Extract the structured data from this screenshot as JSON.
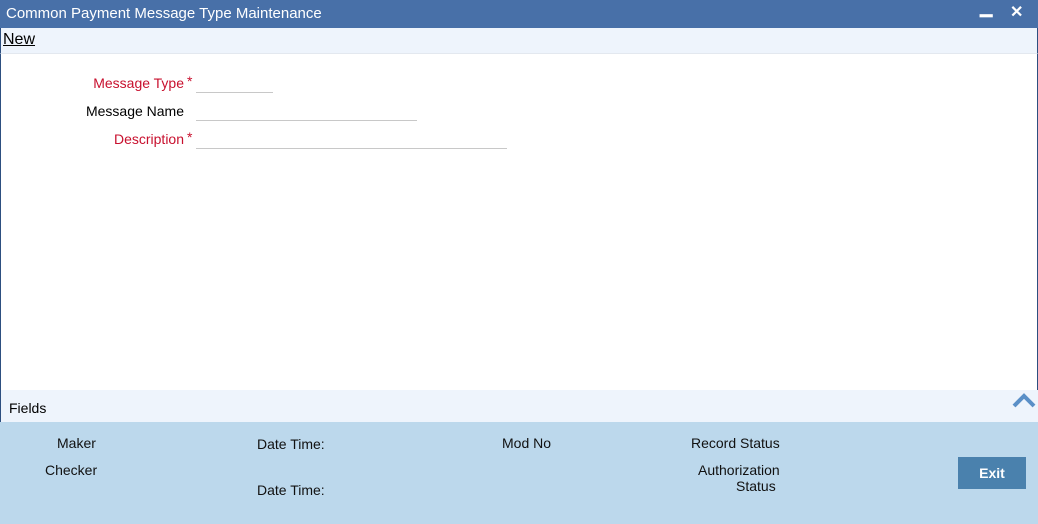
{
  "window": {
    "title": "Common Payment Message Type Maintenance",
    "minimize": "▁",
    "close": "✕"
  },
  "menu": {
    "new": "New"
  },
  "form": {
    "message_type": {
      "label": "Message Type",
      "required": "*",
      "value": ""
    },
    "message_name": {
      "label": "Message Name",
      "value": ""
    },
    "description": {
      "label": "Description",
      "required": "*",
      "value": ""
    }
  },
  "fields_section": {
    "label": "Fields"
  },
  "footer": {
    "maker": "Maker",
    "checker": "Checker",
    "date_time_1": "Date Time:",
    "date_time_2": "Date Time:",
    "mod_no": "Mod No",
    "record_status": "Record Status",
    "authorization_status_1": "Authorization",
    "authorization_status_2": "Status",
    "exit": "Exit"
  }
}
